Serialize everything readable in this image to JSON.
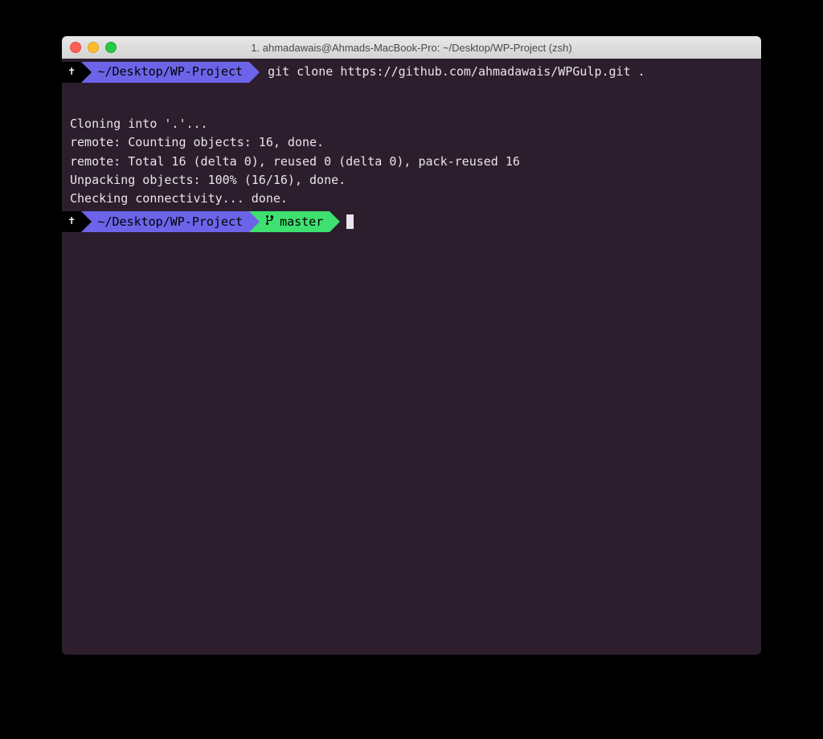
{
  "window": {
    "title": "1. ahmadawais@Ahmads-MacBook-Pro: ~/Desktop/WP-Project (zsh)"
  },
  "prompt1": {
    "symbol": "✝",
    "path": "~/Desktop/WP-Project",
    "command": "git clone https://github.com/ahmadawais/WPGulp.git ."
  },
  "output": {
    "lines": [
      "Cloning into '.'...",
      "remote: Counting objects: 16, done.",
      "remote: Total 16 (delta 0), reused 0 (delta 0), pack-reused 16",
      "Unpacking objects: 100% (16/16), done.",
      "Checking connectivity... done."
    ]
  },
  "prompt2": {
    "symbol": "✝",
    "path": "~/Desktop/WP-Project",
    "branch": "master"
  }
}
